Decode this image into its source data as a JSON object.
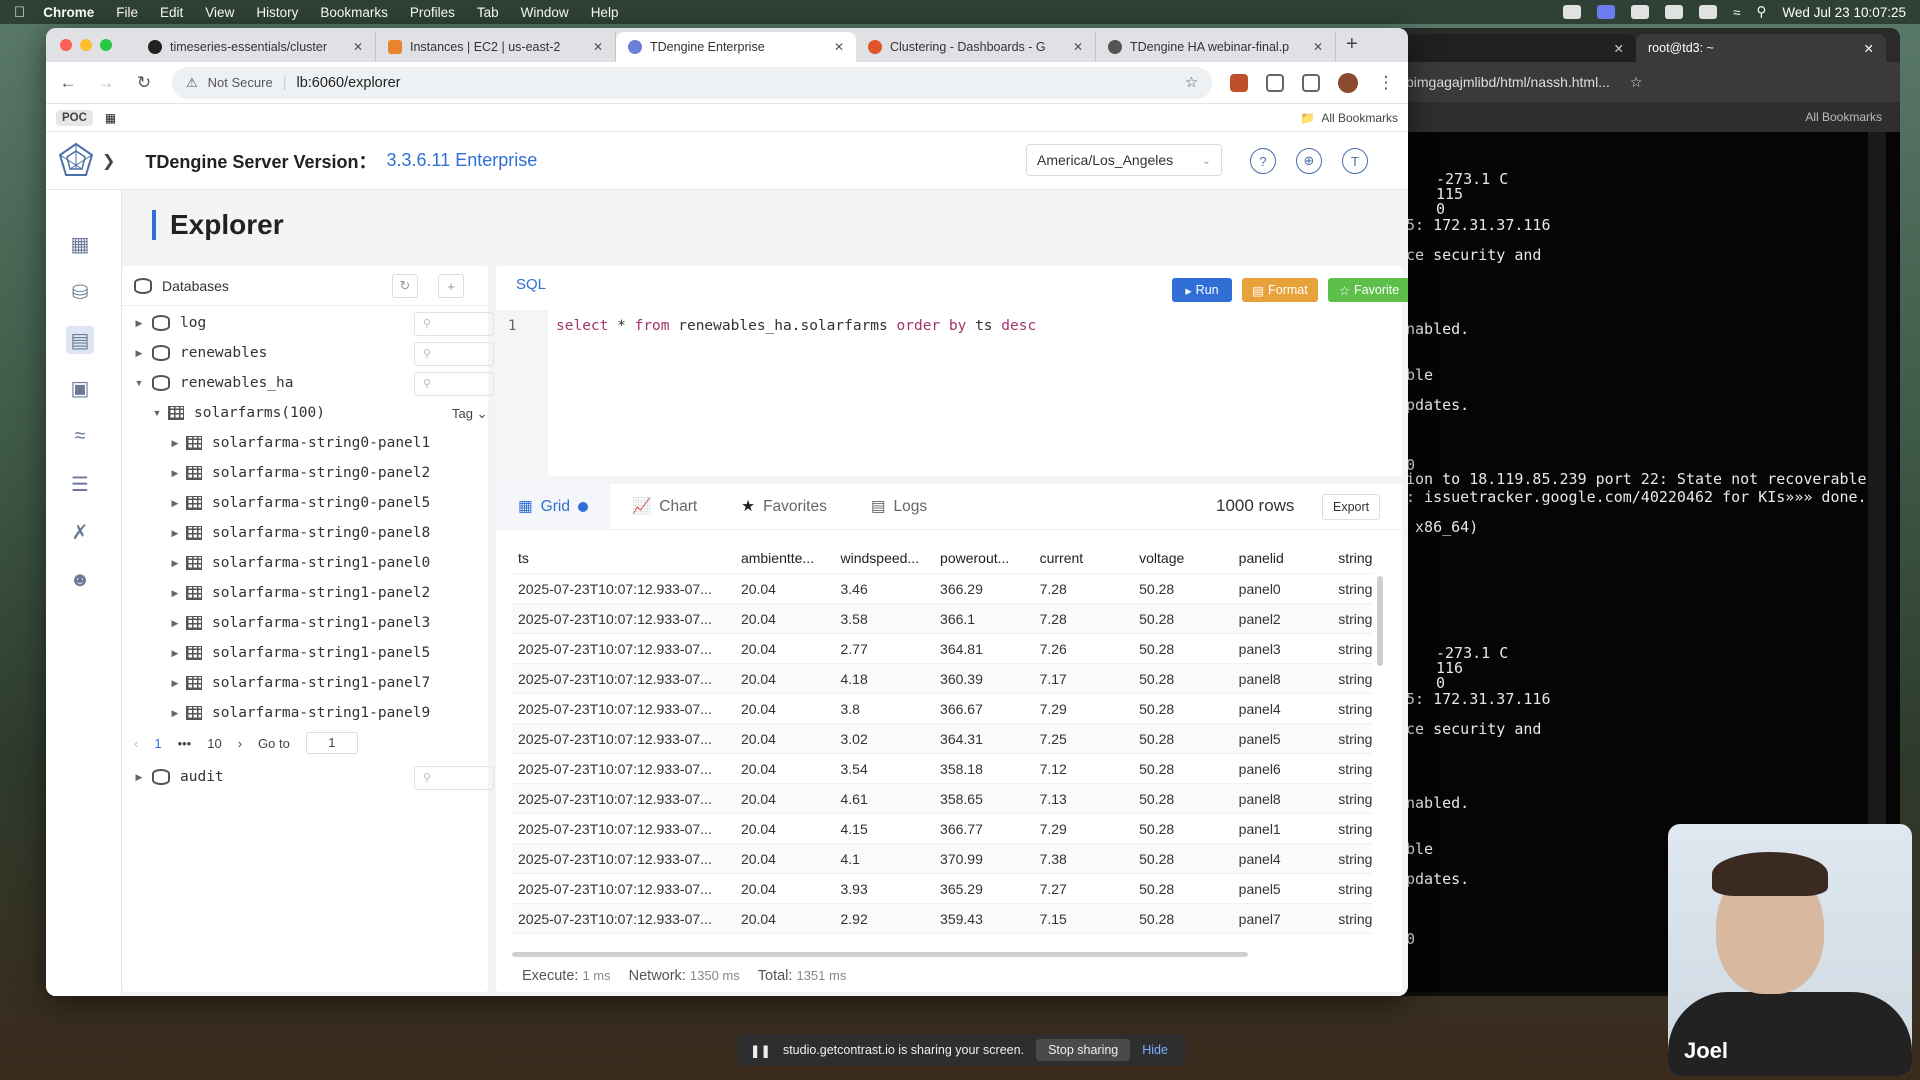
{
  "menubar": {
    "app": "Chrome",
    "items": [
      "File",
      "Edit",
      "View",
      "History",
      "Bookmarks",
      "Profiles",
      "Tab",
      "Window",
      "Help"
    ],
    "clock": "Wed Jul 23  10:07:25"
  },
  "browser": {
    "tabs": [
      {
        "title": "timeseries-essentials/cluster",
        "color": "#222222"
      },
      {
        "title": "Instances | EC2 | us-east-2",
        "color": "#e8842b"
      },
      {
        "title": "TDengine Enterprise",
        "color": "#6a7fd6"
      },
      {
        "title": "Clustering - Dashboards - G",
        "color": "#e0542a"
      },
      {
        "title": "TDengine HA webinar-final.p",
        "color": "#555555"
      }
    ],
    "not_secure": "Not Secure",
    "url": "lb:6060/explorer",
    "bookmark_poc": "POC",
    "all_bookmarks": "All Bookmarks"
  },
  "app": {
    "server_label": "TDengine Server Version：",
    "server_version": "3.3.6.11 Enterprise",
    "timezone": "America/Los_Angeles",
    "page_title": "Explorer",
    "databases_label": "Databases",
    "tree": {
      "dbs_top": [
        "log",
        "renewables",
        "renewables_ha"
      ],
      "stable": "solarfarms(100)",
      "tag_label": "Tag",
      "tables": [
        "solarfarma-string0-panel1",
        "solarfarma-string0-panel2",
        "solarfarma-string0-panel5",
        "solarfarma-string0-panel8",
        "solarfarma-string1-panel0",
        "solarfarma-string1-panel2",
        "solarfarma-string1-panel3",
        "solarfarma-string1-panel5",
        "solarfarma-string1-panel7",
        "solarfarma-string1-panel9"
      ],
      "pager": {
        "first": "1",
        "ellipsis": "•••",
        "last": "10",
        "goto_label": "Go to",
        "goto_value": "1"
      },
      "db_bottom": "audit"
    },
    "sql": {
      "tab": "SQL",
      "run": "Run",
      "format": "Format",
      "favorite": "Favorite",
      "line_no": "1",
      "query_parts": [
        "select",
        " * ",
        "from",
        " renewables_ha.solarfarms ",
        "order by",
        " ts ",
        "desc"
      ]
    },
    "results": {
      "tabs": {
        "grid": "Grid",
        "chart": "Chart",
        "favorites": "Favorites",
        "logs": "Logs"
      },
      "rows_count": "1000 rows",
      "export": "Export",
      "columns": [
        "ts",
        "ambientte...",
        "windspeed...",
        "powerout...",
        "current",
        "voltage",
        "panelid",
        "string"
      ],
      "rows": [
        [
          "2025-07-23T10:07:12.933-07...",
          "20.04",
          "3.46",
          "366.29",
          "7.28",
          "50.28",
          "panel0",
          "string"
        ],
        [
          "2025-07-23T10:07:12.933-07...",
          "20.04",
          "3.58",
          "366.1",
          "7.28",
          "50.28",
          "panel2",
          "string"
        ],
        [
          "2025-07-23T10:07:12.933-07...",
          "20.04",
          "2.77",
          "364.81",
          "7.26",
          "50.28",
          "panel3",
          "string"
        ],
        [
          "2025-07-23T10:07:12.933-07...",
          "20.04",
          "4.18",
          "360.39",
          "7.17",
          "50.28",
          "panel8",
          "string"
        ],
        [
          "2025-07-23T10:07:12.933-07...",
          "20.04",
          "3.8",
          "366.67",
          "7.29",
          "50.28",
          "panel4",
          "string"
        ],
        [
          "2025-07-23T10:07:12.933-07...",
          "20.04",
          "3.02",
          "364.31",
          "7.25",
          "50.28",
          "panel5",
          "string"
        ],
        [
          "2025-07-23T10:07:12.933-07...",
          "20.04",
          "3.54",
          "358.18",
          "7.12",
          "50.28",
          "panel6",
          "string"
        ],
        [
          "2025-07-23T10:07:12.933-07...",
          "20.04",
          "4.61",
          "358.65",
          "7.13",
          "50.28",
          "panel8",
          "string"
        ],
        [
          "2025-07-23T10:07:12.933-07...",
          "20.04",
          "4.15",
          "366.77",
          "7.29",
          "50.28",
          "panel1",
          "string"
        ],
        [
          "2025-07-23T10:07:12.933-07...",
          "20.04",
          "4.1",
          "370.99",
          "7.38",
          "50.28",
          "panel4",
          "string"
        ],
        [
          "2025-07-23T10:07:12.933-07...",
          "20.04",
          "3.93",
          "365.29",
          "7.27",
          "50.28",
          "panel5",
          "string"
        ],
        [
          "2025-07-23T10:07:12.933-07...",
          "20.04",
          "2.92",
          "359.43",
          "7.15",
          "50.28",
          "panel7",
          "string"
        ]
      ],
      "execute_label": "Execute:",
      "execute_value": "1 ms",
      "network_label": "Network:",
      "network_value": "1350 ms",
      "total_label": "Total:",
      "total_value": "1351 ms"
    }
  },
  "terminal": {
    "tab1": "",
    "tab2": "root@td3: ~",
    "address_fragment": "bimgagajmlibd/html/nassh.html...",
    "all_bookmarks": "All Bookmarks",
    "lines": [
      "-273.1 C",
      "115",
      "0",
      "5: 172.31.37.116",
      "ce security and",
      "nabled.",
      "ble",
      "pdates.",
      "0",
      "ion to 18.119.85.239 port 22: State not recoverable",
      ": issuetracker.google.com/40220462 for KIs»»» done.",
      " x86_64)",
      "-273.1 C",
      "116",
      "0",
      "5: 172.31.37.116",
      "ce security and",
      "nabled.",
      "ble",
      "pdates.",
      "0"
    ]
  },
  "sharing": {
    "text": "studio.getcontrast.io is sharing your screen.",
    "stop": "Stop sharing",
    "hide": "Hide"
  },
  "webcam": {
    "name": "Joel"
  }
}
